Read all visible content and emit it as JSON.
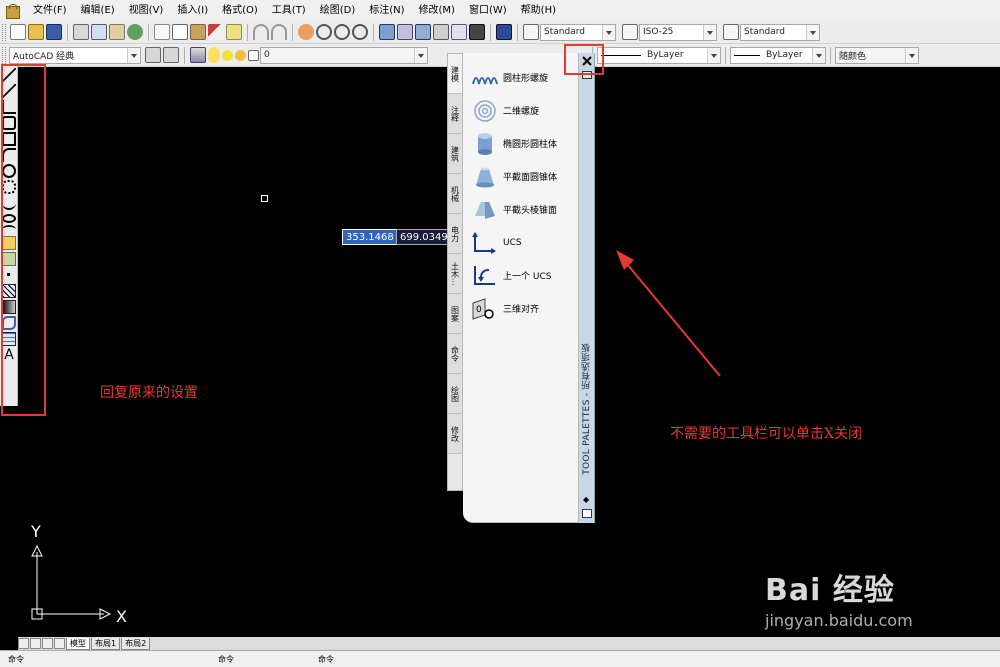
{
  "menubar": {
    "items": [
      "文件(F)",
      "编辑(E)",
      "视图(V)",
      "插入(I)",
      "格式(O)",
      "工具(T)",
      "绘图(D)",
      "标注(N)",
      "修改(M)",
      "窗口(W)",
      "帮助(H)"
    ]
  },
  "toolbar": {
    "text_style": "Standard",
    "dim_style": "ISO-25",
    "table_style": "Standard",
    "workspace": "AutoCAD 经典",
    "layer": "0",
    "linetype": "ByLayer",
    "lineweight": "ByLayer",
    "plot_style": "随颜色"
  },
  "palette": {
    "tabs": [
      "建模",
      "注释",
      "建筑",
      "机械",
      "电力",
      "土木...",
      "图案",
      "命令",
      "绘图",
      "修改"
    ],
    "items": [
      {
        "label": "圆柱形螺旋",
        "icon": "helix-icon"
      },
      {
        "label": "二维螺旋",
        "icon": "spiral-icon"
      },
      {
        "label": "椭圆形圆柱体",
        "icon": "elliptic-cylinder-icon"
      },
      {
        "label": "平截面圆锥体",
        "icon": "frustum-cone-icon"
      },
      {
        "label": "平截头棱锥面",
        "icon": "frustum-pyramid-icon"
      },
      {
        "label": "UCS",
        "icon": "ucs-icon"
      },
      {
        "label": "上一个 UCS",
        "icon": "ucs-previous-icon"
      },
      {
        "label": "三维对齐",
        "icon": "3d-align-icon"
      }
    ],
    "title": "TOOL PALETTES - 所有选项板"
  },
  "canvas": {
    "coord_x": "353.1468",
    "coord_y": "699.0349",
    "axis_x": "X",
    "axis_y": "Y"
  },
  "annotations": {
    "restore": "回复原来的设置",
    "close_hint": "不需要的工具栏可以单击X关闭"
  },
  "layout_tabs": [
    "模型",
    "布局1",
    "布局2"
  ],
  "status": {
    "cmd": "命令",
    "s1": "命令",
    "s2": "命令"
  },
  "watermark": {
    "brand": "Bai  经验",
    "url": "jingyan.baidu.com"
  },
  "colors": {
    "accent_red": "#e53935",
    "canvas": "#000000",
    "coord_highlight": "#3064b8"
  }
}
